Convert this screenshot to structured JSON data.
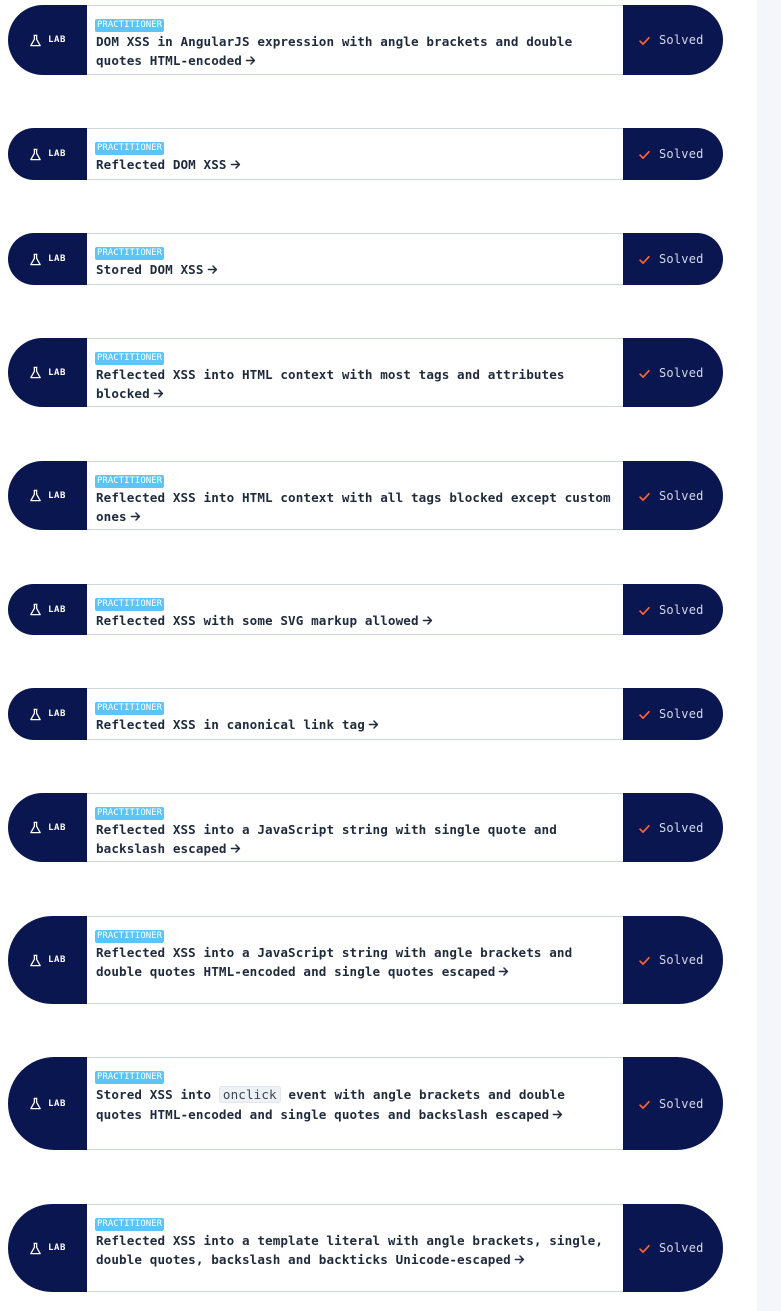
{
  "labs": [
    {
      "tag": "LAB",
      "level": "PRACTITIONER",
      "title": "DOM XSS in AngularJS expression with angle brackets and double quotes HTML-encoded",
      "status": "Solved"
    },
    {
      "tag": "LAB",
      "level": "PRACTITIONER",
      "title": "Reflected DOM XSS",
      "status": "Solved"
    },
    {
      "tag": "LAB",
      "level": "PRACTITIONER",
      "title": "Stored DOM XSS",
      "status": "Solved"
    },
    {
      "tag": "LAB",
      "level": "PRACTITIONER",
      "title": "Reflected XSS into HTML context with most tags and attributes blocked",
      "status": "Solved"
    },
    {
      "tag": "LAB",
      "level": "PRACTITIONER",
      "title": "Reflected XSS into HTML context with all tags blocked except custom ones",
      "status": "Solved"
    },
    {
      "tag": "LAB",
      "level": "PRACTITIONER",
      "title": "Reflected XSS with some SVG markup allowed",
      "status": "Solved"
    },
    {
      "tag": "LAB",
      "level": "PRACTITIONER",
      "title": "Reflected XSS in canonical link tag",
      "status": "Solved"
    },
    {
      "tag": "LAB",
      "level": "PRACTITIONER",
      "title": "Reflected XSS into a JavaScript string with single quote and backslash escaped",
      "status": "Solved"
    },
    {
      "tag": "LAB",
      "level": "PRACTITIONER",
      "title": "Reflected XSS into a JavaScript string with angle brackets and double quotes HTML-encoded and single quotes escaped",
      "status": "Solved"
    },
    {
      "tag": "LAB",
      "level": "PRACTITIONER",
      "title_before": "Stored XSS into ",
      "title_code": "onclick",
      "title_after": " event with angle brackets and double quotes HTML-encoded and single quotes and backslash escaped",
      "status": "Solved"
    },
    {
      "tag": "LAB",
      "level": "PRACTITIONER",
      "title": "Reflected XSS into a template literal with angle brackets, single, double quotes, backslash and backticks Unicode-escaped",
      "status": "Solved"
    }
  ],
  "colors": {
    "navy": "#0a1650",
    "badge": "#5cc5f5",
    "check": "#ff6633",
    "title": "#1f2a3d"
  },
  "icons": {
    "tag_icon": "flask-icon",
    "link_icon": "arrow-right-icon",
    "status_icon": "check-icon"
  }
}
